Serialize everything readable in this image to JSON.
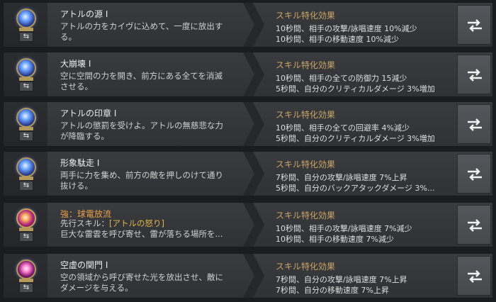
{
  "effect_header": "スキル特化効果",
  "skills": [
    {
      "icon": "lightning-orb-icon",
      "name": "アトルの源 I",
      "description": [
        "アトルの力をカイヴに込めて、一度に放出す",
        "る。"
      ],
      "effects": [
        "10秒間、相手の攻撃/詠唱速度 10%減少",
        "10秒間、相手の移動速度 10%減少"
      ]
    },
    {
      "icon": "sphere-burst-icon",
      "name": "大崩壊 I",
      "description": [
        "空に空間の力を開き、前方にある全てを消滅",
        "させる。"
      ],
      "effects": [
        "10秒間、相手の全ての防御力 15減少",
        "5秒間、自分のクリティカルダメージ 3%増加"
      ]
    },
    {
      "icon": "seal-icon",
      "name": "アトルの印章 I",
      "description": [
        "アトルの懲罰を受けよ。アトルの無慈悲な力",
        "が降臨する。"
      ],
      "effects": [
        "10秒間、相手の全ての回避率 4%減少",
        "5秒間、自分のクリティカルダメージ 3%増加"
      ]
    },
    {
      "icon": "surge-icon",
      "name": "形象駄走 I",
      "description": [
        "両手に力を集め、前方の敵を押しのけて通り",
        "抜ける。"
      ],
      "effects": [
        "7秒間、自分の攻撃/詠唱速度 7%上昇",
        "5秒間、自分のバックアタックダメージ 3%..."
      ]
    },
    {
      "icon": "thunder-ball-icon",
      "name": "強：球電放流",
      "prereq_label": "先行スキル：",
      "prereq_skill": "[アトルの怒り]",
      "description": [
        "巨大な雷雲を呼び寄せ、雷が落ちる場所を..."
      ],
      "effects": [
        "10秒間、相手の攻撃/詠唱速度 7%減少",
        "10秒間、相手の移動速度 7%減少"
      ]
    },
    {
      "icon": "void-gate-icon",
      "name": "空虚の関門 I",
      "description": [
        "空の領域から呼び寄せた光を放出させ、敵に",
        "ダメージを与える。"
      ],
      "effects": [
        "7秒間、自分の攻撃/詠唱速度 7%上昇",
        "7秒間、自分の移動速度 7%上昇"
      ]
    }
  ],
  "colors": {
    "header_gold": "#c9a766",
    "highlight_orange": "#e8a04a",
    "prereq_gold": "#e0b84a"
  }
}
